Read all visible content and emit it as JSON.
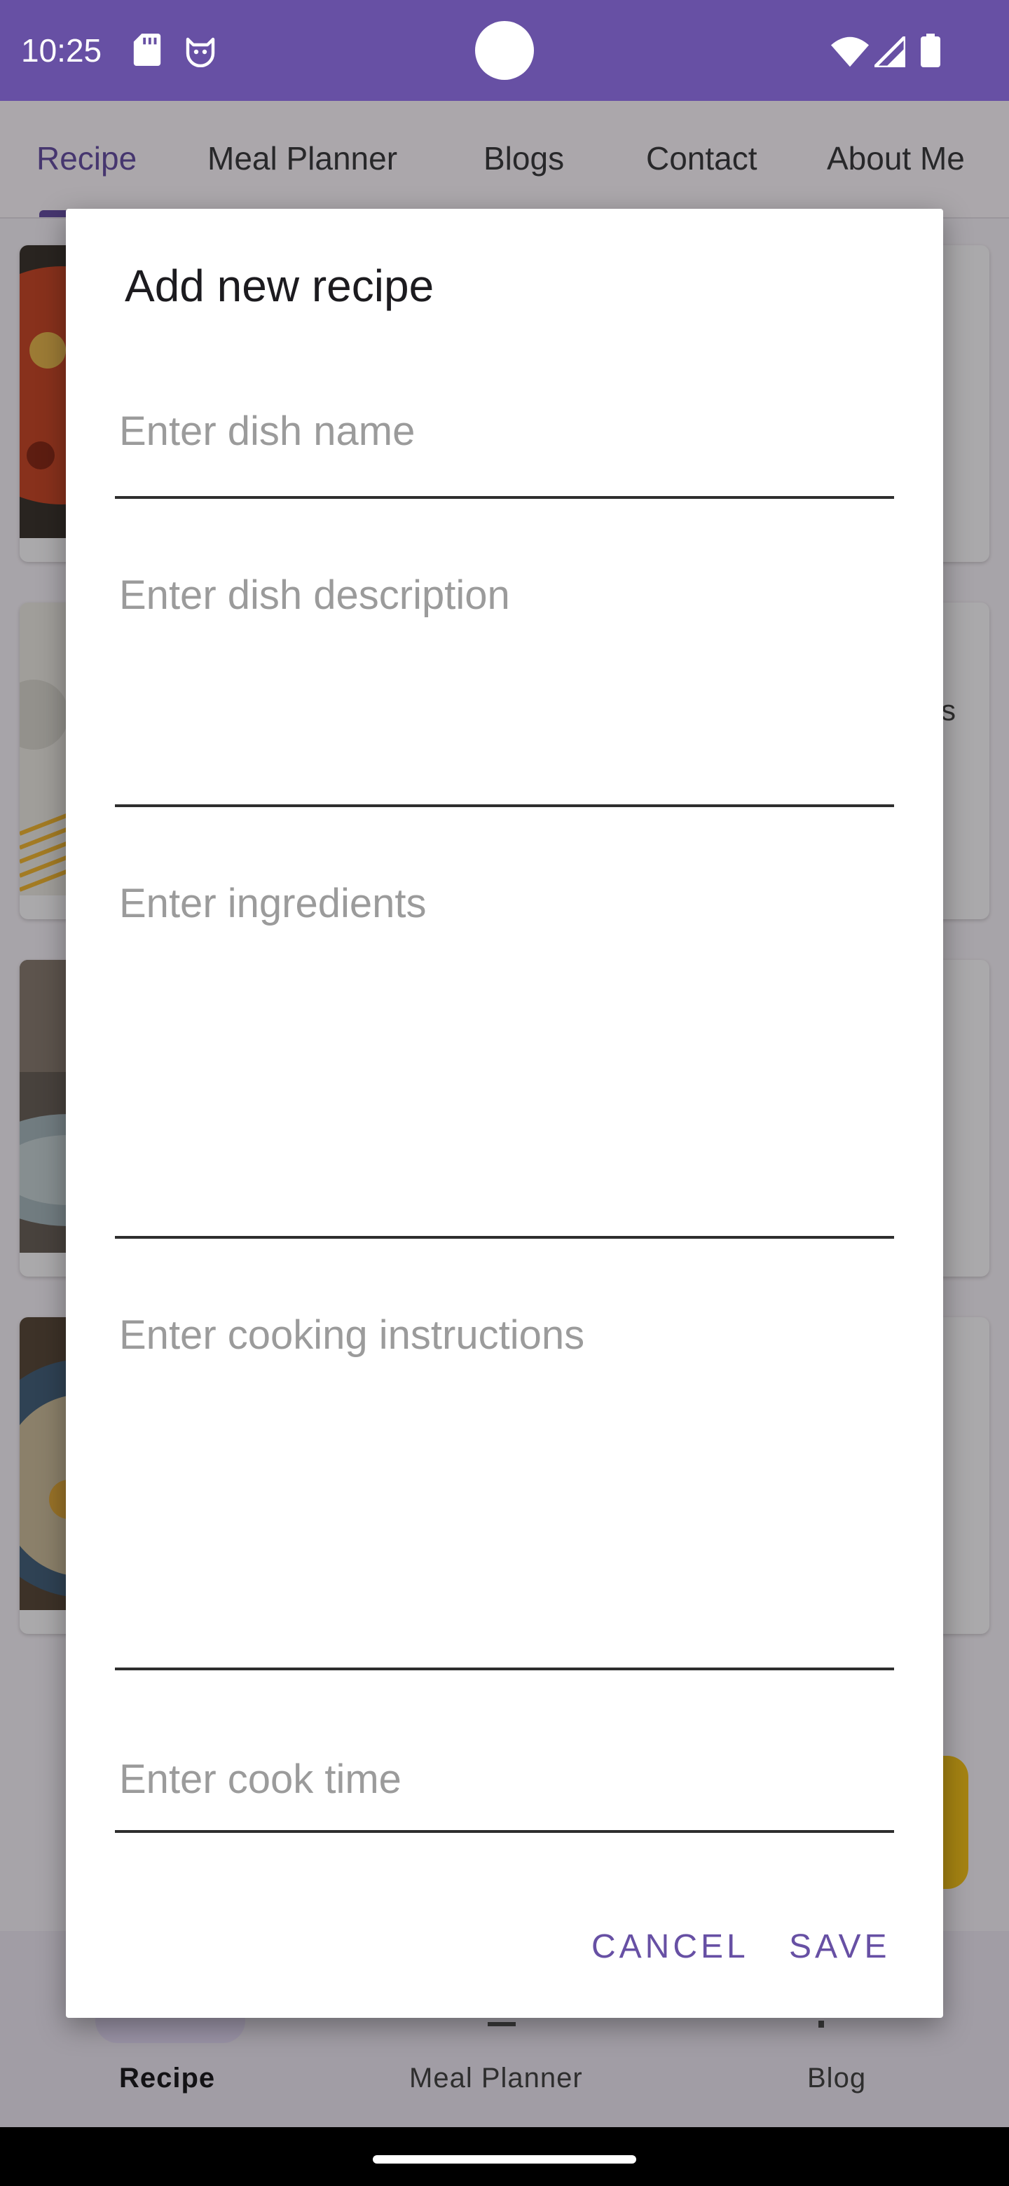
{
  "status_bar": {
    "time": "10:25",
    "icons": [
      "sd-card-icon",
      "cat-notification-icon",
      "wifi-icon",
      "signal-icon",
      "battery-icon"
    ],
    "background": "#6750a4"
  },
  "top_tabs": {
    "items": [
      {
        "label": "Recipe",
        "active": true
      },
      {
        "label": "Meal Planner",
        "active": false
      },
      {
        "label": "Blogs",
        "active": false
      },
      {
        "label": "Contact",
        "active": false
      },
      {
        "label": "About Me",
        "active": false
      }
    ],
    "accent": "#6750a4"
  },
  "bottom_nav": {
    "items": [
      {
        "label": "Recipe",
        "active": true
      },
      {
        "label": "Meal Planner",
        "active": false
      },
      {
        "label": "Blog",
        "active": false
      }
    ]
  },
  "background_cards": {
    "partial_text": "s"
  },
  "dialog": {
    "title": "Add new recipe",
    "fields": {
      "dish_name": {
        "value": "",
        "placeholder": "Enter dish name"
      },
      "dish_description": {
        "value": "",
        "placeholder": "Enter dish description"
      },
      "ingredients": {
        "value": "",
        "placeholder": "Enter ingredients"
      },
      "cooking_instructions": {
        "value": "",
        "placeholder": "Enter cooking instructions"
      },
      "cook_time": {
        "value": "",
        "placeholder": "Enter cook time"
      }
    },
    "buttons": {
      "cancel": "CANCEL",
      "save": "SAVE"
    },
    "button_color": "#6750a4"
  },
  "fab_color": "#f4c21b"
}
